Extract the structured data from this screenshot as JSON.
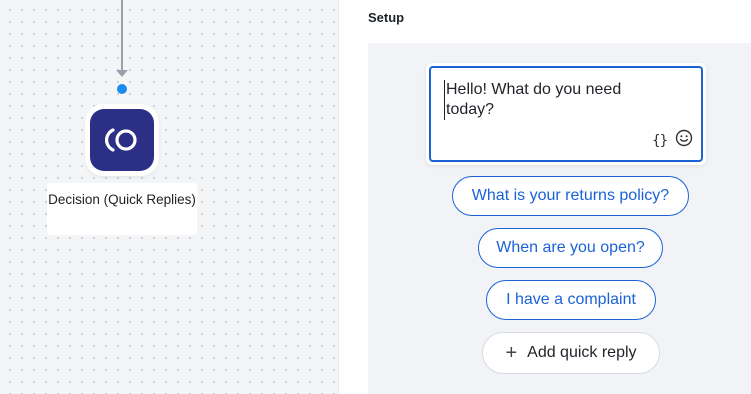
{
  "canvas": {
    "node": {
      "label": "Decision (Quick Replies)",
      "icon": "decision-quick-replies-icon",
      "icon_color": "#2b2f86"
    },
    "connector_dot_color": "#1a8cf0"
  },
  "panel": {
    "title": "Setup",
    "message": {
      "text": "Hello! What do you need today?",
      "variable_icon": "{}",
      "emoji_icon": "smiley-icon"
    },
    "quick_replies": [
      {
        "label": "What is your returns policy?"
      },
      {
        "label": "When are you open?"
      },
      {
        "label": "I have a complaint"
      }
    ],
    "add_quick_reply": {
      "label": "Add quick reply",
      "icon": "+"
    },
    "accent_color": "#1a62d6"
  }
}
